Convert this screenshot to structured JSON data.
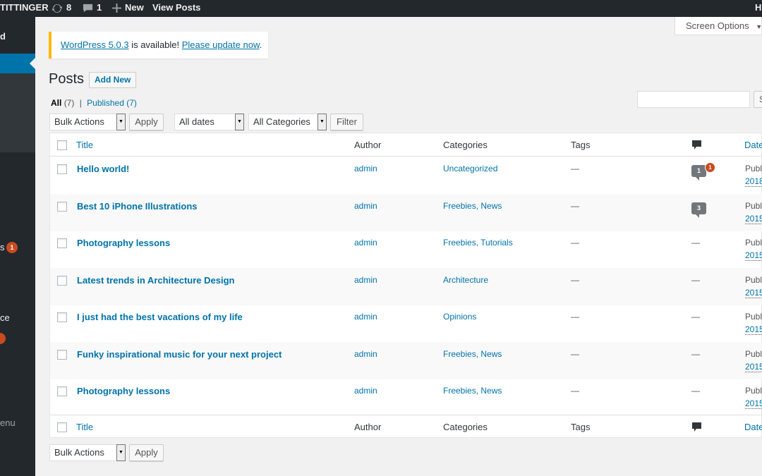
{
  "adminbar": {
    "site_name": "TITTINGER",
    "updates_count": "8",
    "comments_count": "1",
    "new_label": "New",
    "view_posts_label": "View Posts",
    "howdy_label": "H"
  },
  "sidebar": {
    "item_top": "d",
    "item_comments_suffix": "s",
    "comments_badge": "1",
    "item_appearance_suffix": "ce",
    "collapse_suffix": "enu"
  },
  "notice": {
    "version_link": "WordPress 5.0.3",
    "middle_text": " is available! ",
    "update_link": "Please update now",
    "end_text": "."
  },
  "screen_options": "Screen Options",
  "page": {
    "title": "Posts",
    "add_new": "Add New"
  },
  "views": {
    "all_label": "All",
    "all_count": "(7)",
    "separator": "|",
    "published_label": "Published",
    "published_count": "(7)"
  },
  "search_button": "S",
  "filters": {
    "bulk_actions": "Bulk Actions",
    "apply": "Apply",
    "dates": "All dates",
    "categories": "All Categories",
    "filter": "Filter"
  },
  "columns": {
    "title": "Title",
    "author": "Author",
    "categories": "Categories",
    "tags": "Tags",
    "date": "Date"
  },
  "posts": [
    {
      "title": "Hello world!",
      "author": "admin",
      "categories": "Uncategorized",
      "tags": "—",
      "comments": "1",
      "pending": "1",
      "date1": "Publ",
      "date2": "2018"
    },
    {
      "title": "Best 10 iPhone Illustrations",
      "author": "admin",
      "categories": "Freebies, News",
      "tags": "—",
      "comments": "3",
      "pending": "",
      "date1": "Publ",
      "date2": "2015"
    },
    {
      "title": "Photography lessons",
      "author": "admin",
      "categories": "Freebies, Tutorials",
      "tags": "—",
      "comments": "—",
      "pending": "",
      "date1": "Publ",
      "date2": "2015"
    },
    {
      "title": "Latest trends in Architecture Design",
      "author": "admin",
      "categories": "Architecture",
      "tags": "—",
      "comments": "—",
      "pending": "",
      "date1": "Publ",
      "date2": "2015"
    },
    {
      "title": "I just had the best vacations of my life",
      "author": "admin",
      "categories": "Opinions",
      "tags": "—",
      "comments": "—",
      "pending": "",
      "date1": "Publ",
      "date2": "2015"
    },
    {
      "title": "Funky inspirational music for your next project",
      "author": "admin",
      "categories": "Freebies, News",
      "tags": "—",
      "comments": "—",
      "pending": "",
      "date1": "Publ",
      "date2": "2015"
    },
    {
      "title": "Photography lessons",
      "author": "admin",
      "categories": "Freebies, News",
      "tags": "—",
      "comments": "—",
      "pending": "",
      "date1": "Publ",
      "date2": "2015"
    }
  ],
  "colors": {
    "link": "#0073aa",
    "admin_bar": "#23282d",
    "notice_border": "#ffb900",
    "badge": "#ca4a1f"
  }
}
